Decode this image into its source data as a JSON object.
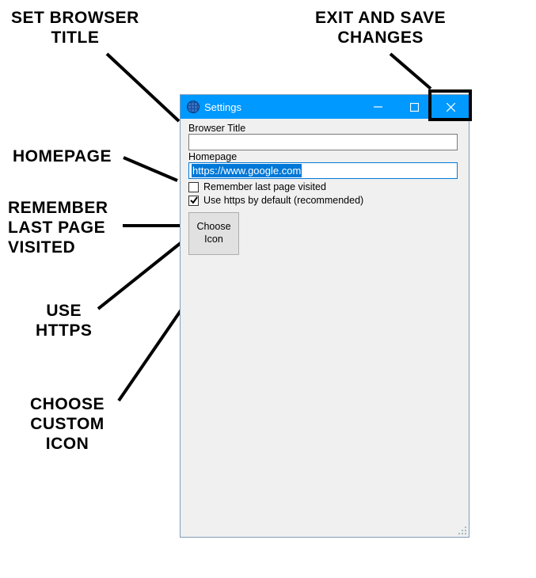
{
  "annotations": {
    "set_title": "SET BROWSER\nTITLE",
    "exit_save": "EXIT AND SAVE\nCHANGES",
    "homepage": "HOMEPAGE",
    "remember": "REMEMBER\nLAST PAGE\nVISITED",
    "use_https": "USE\nHTTPS",
    "choose_icon": "CHOOSE\nCUSTOM\nICON"
  },
  "window": {
    "title": "Settings",
    "browser_title_label": "Browser Title",
    "browser_title_value": "",
    "homepage_label": "Homepage",
    "homepage_value": "https://www.google.com",
    "remember_label": "Remember last page visited",
    "remember_checked": false,
    "use_https_label": "Use https by default (recommended)",
    "use_https_checked": true,
    "choose_icon_label": "Choose\nIcon"
  }
}
